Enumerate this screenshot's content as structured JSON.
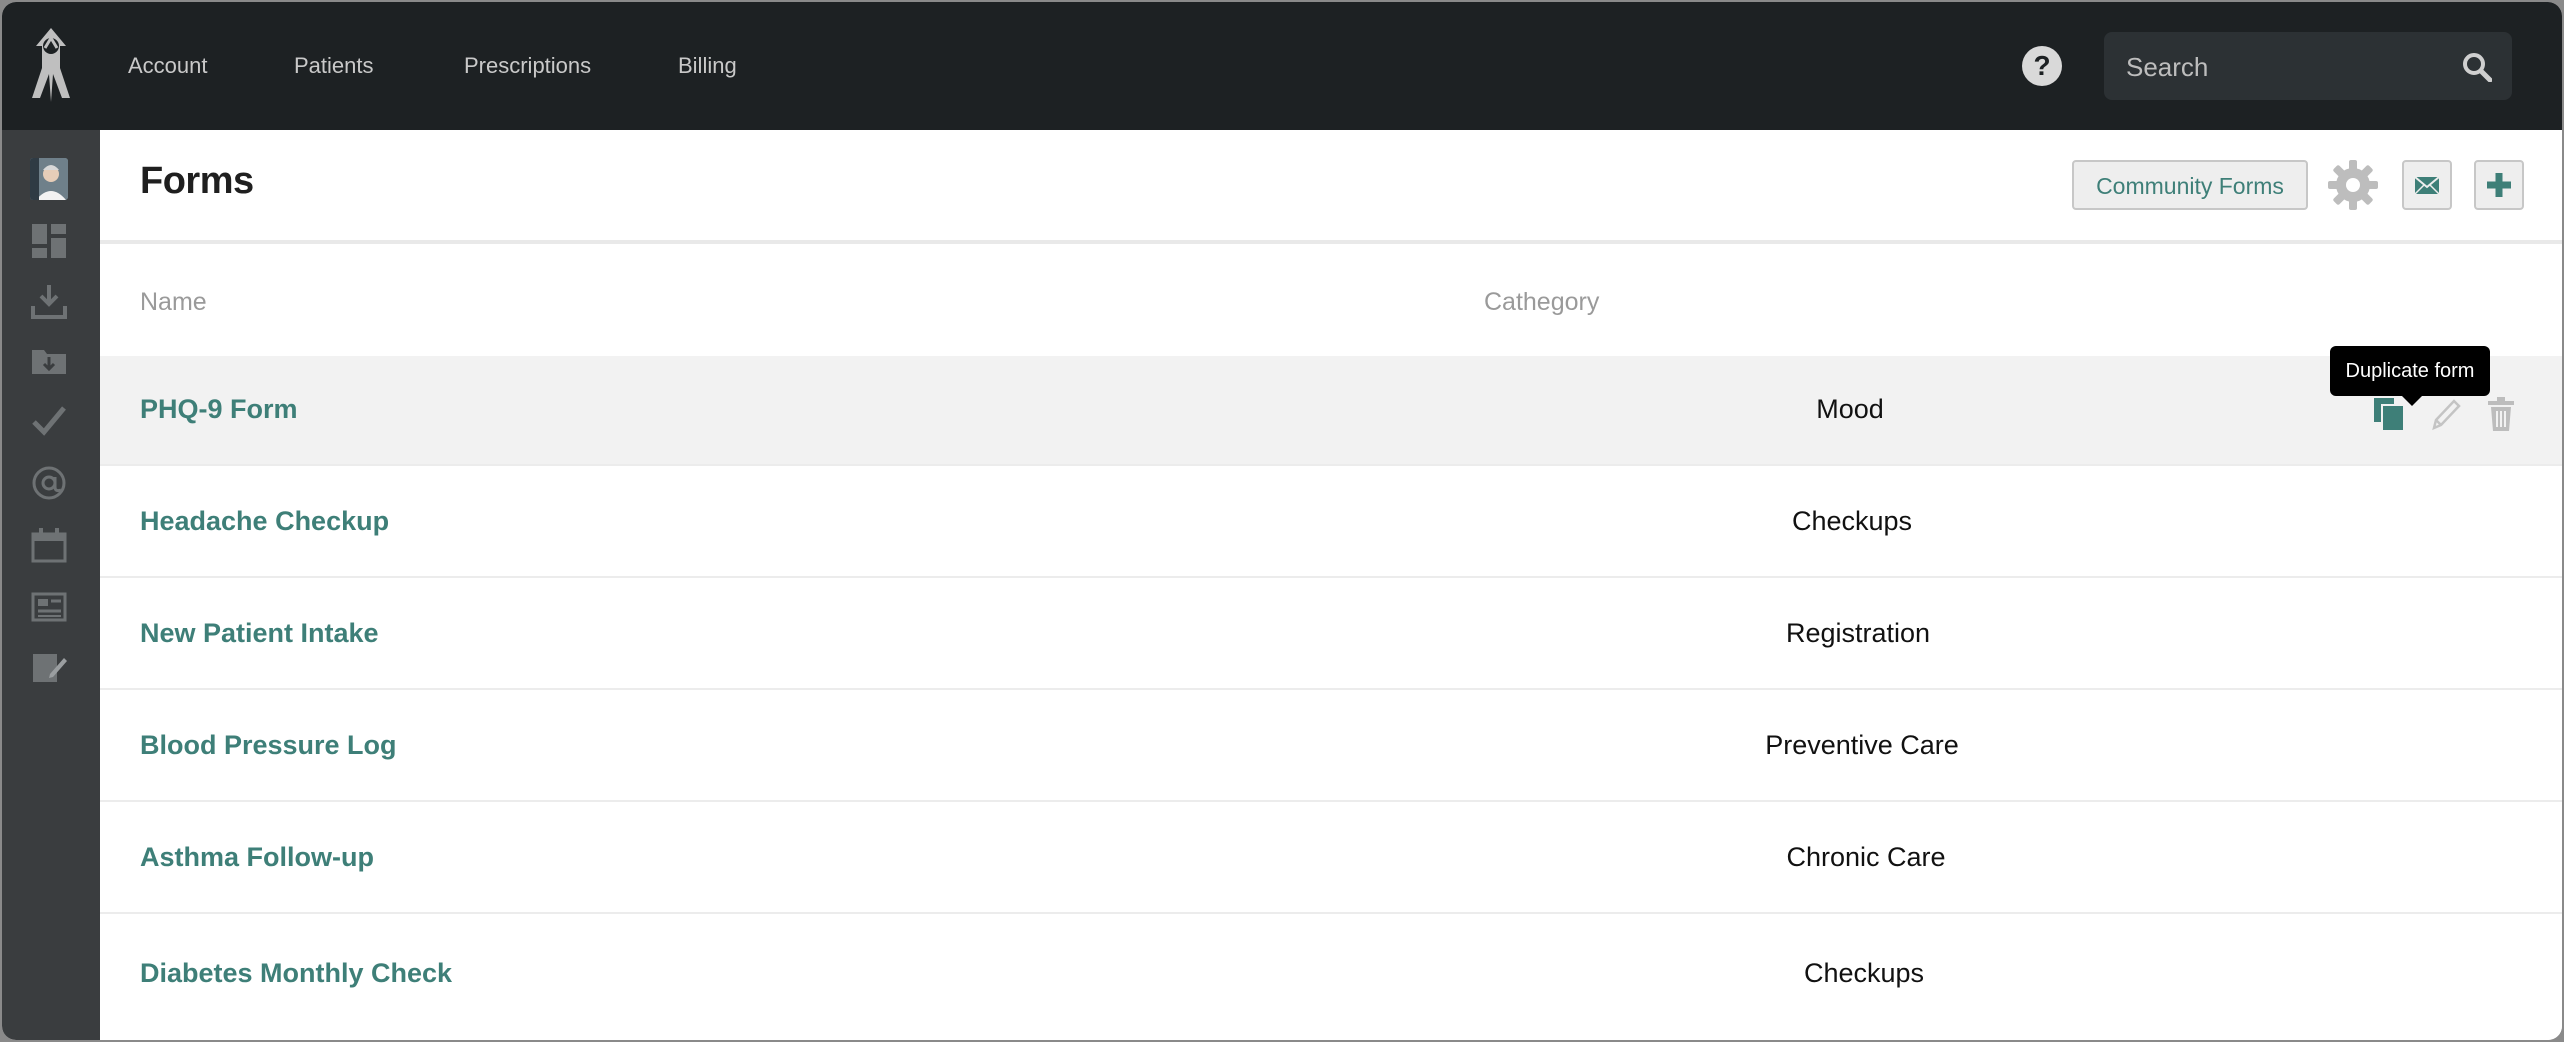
{
  "nav": {
    "items": [
      {
        "label": "Account"
      },
      {
        "label": "Patients"
      },
      {
        "label": "Prescriptions"
      },
      {
        "label": "Billing"
      }
    ],
    "help_label": "?",
    "search_placeholder": "Search"
  },
  "sidebar": {
    "icons": [
      "dashboard-icon",
      "download-icon",
      "folder-download-icon",
      "checkmark-icon",
      "at-sign-icon",
      "calendar-icon",
      "news-icon",
      "edit-document-icon"
    ]
  },
  "header": {
    "title": "Forms",
    "community_forms_label": "Community Forms"
  },
  "table": {
    "columns": {
      "name": "Name",
      "category": "Cathegory"
    },
    "rows": [
      {
        "name": "PHQ-9 Form",
        "category": "Mood"
      },
      {
        "name": "Headache Checkup",
        "category": "Checkups"
      },
      {
        "name": "New Patient Intake",
        "category": "Registration"
      },
      {
        "name": "Blood Pressure Log",
        "category": "Preventive Care"
      },
      {
        "name": "Asthma Follow-up",
        "category": "Chronic Care"
      },
      {
        "name": "Diabetes Monthly Check",
        "category": "Checkups"
      }
    ]
  },
  "tooltip": "Duplicate form",
  "colors": {
    "accent": "#3e7f78",
    "topbar": "#1d2123",
    "sidebar": "#3a3d3f",
    "icon_gray": "#bbbbbb"
  }
}
